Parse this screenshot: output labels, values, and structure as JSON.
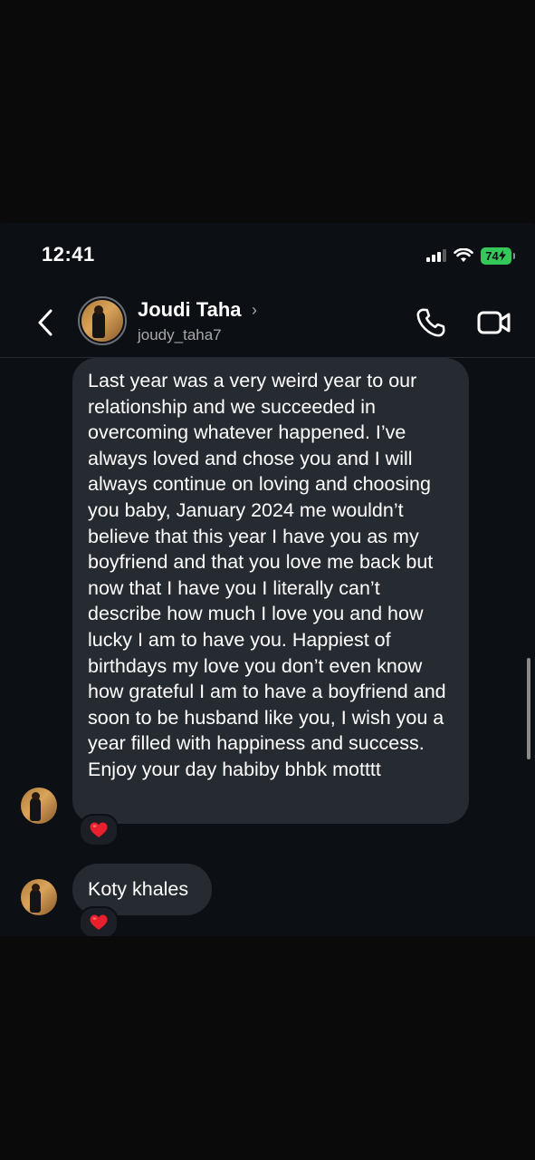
{
  "status_bar": {
    "time": "12:41",
    "battery": "74"
  },
  "header": {
    "name": "Joudi Taha",
    "name_chevron": "›",
    "username": "joudy_taha7"
  },
  "messages": [
    {
      "text": "Last year was a very weird year to our relationship and we succeeded in overcoming whatever happened. I’ve always loved and chose you and I will always continue on loving and choosing you baby, January 2024 me wouldn’t believe that this year I have you as my boyfriend and that you love me back but now that I have you I literally can’t describe how much I love you and how lucky I am to have you. Happiest of birthdays my love you don’t even know how grateful I am to have a boyfriend and soon to be husband like you, I wish you a year filled with happiness and success. Enjoy your day habiby bhbk motttt",
      "reaction": "heart-icon"
    },
    {
      "text": "Koty khales",
      "reaction": "heart-icon"
    }
  ],
  "colors": {
    "background": "#0c1014",
    "bubble": "#262a31",
    "battery": "#34c759",
    "heart": "#e8202e"
  }
}
